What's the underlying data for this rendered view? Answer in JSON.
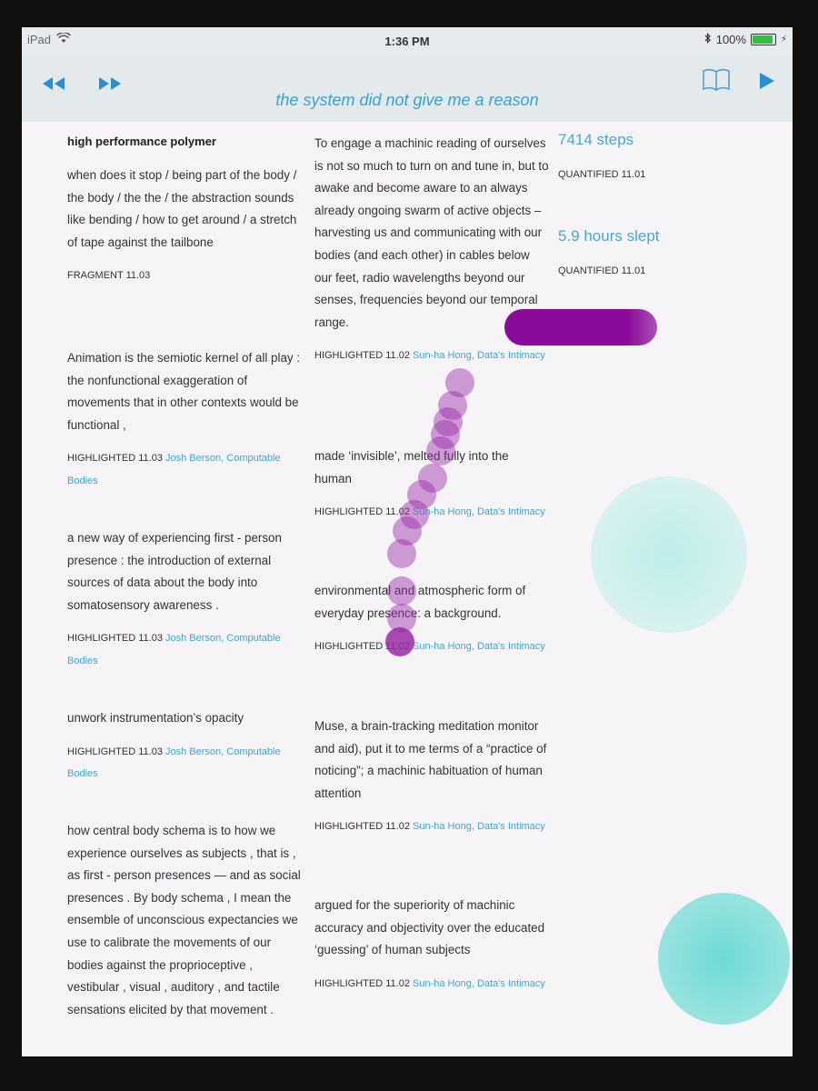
{
  "status": {
    "device": "iPad",
    "time": "1:36 PM",
    "battery_text": "100%",
    "battery_level": 1.0
  },
  "navbar": {
    "title": "the system did not give me a reason",
    "icons": [
      "rewind-icon",
      "fast-forward-icon",
      "book-icon",
      "play-icon"
    ]
  },
  "column1": [
    {
      "title": "high performance polymer",
      "text": "when does it stop / being part of the body / the body / the the / the abstraction sounds like bending / how to get around / a stretch of tape against the tailbone",
      "meta": "FRAGMENT 11.03",
      "source": ""
    },
    {
      "title": "",
      "text": "Animation is the semiotic kernel of all play : the nonfunctional exaggeration of movements that in other contexts would be functional ,",
      "meta": "HIGHLIGHTED 11.03",
      "source": "Josh Berson, Computable Bodies"
    },
    {
      "title": "",
      "text": "a new way of experiencing first - person presence : the introduction of external sources of data about the body into somatosensory awareness .",
      "meta": "HIGHLIGHTED 11.03",
      "source": "Josh Berson, Computable Bodies"
    },
    {
      "title": "",
      "text": "unwork instrumentation’s opacity",
      "meta": "HIGHLIGHTED 11.03",
      "source": "Josh Berson, Computable Bodies"
    },
    {
      "title": "",
      "text": "how central body schema is to how we experience ourselves as subjects , that is , as first - person presences — and as social presences . By body schema , I mean the ensemble of unconscious expectancies we use to calibrate the movements of our bodies against the proprioceptive , vestibular , visual , auditory , and tactile sensations elicited by that movement .",
      "meta": "",
      "source": ""
    }
  ],
  "column2": [
    {
      "text": "To engage a machinic reading of ourselves is not so much to turn on and tune in, but to awake and become aware to an always already ongoing swarm of active objects – harvesting us and communicating with our bodies (and each other) in cables below our feet, radio wavelengths beyond our senses, frequencies beyond our temporal range.",
      "meta": "HIGHLIGHTED 11.02",
      "source": "Sun-ha Hong, Data's Intimacy"
    },
    {
      "text": "made ‘invisible’, melted fully into the human",
      "meta": "HIGHLIGHTED 11.02",
      "source": "Sun-ha Hong, Data's Intimacy"
    },
    {
      "text": "environmental and atmospheric form of everyday presence: a background.",
      "meta": "HIGHLIGHTED 11.02",
      "source": "Sun-ha Hong, Data's Intimacy"
    },
    {
      "text": "Muse, a brain-tracking meditation monitor and aid), put it to me terms of a “practice of noticing”; a machinic habituation of human attention",
      "meta": "HIGHLIGHTED 11.02",
      "source": "Sun-ha Hong, Data's Intimacy"
    },
    {
      "text": "argued for the superiority of machinic accuracy and objectivity over the educated ‘guessing’ of human subjects",
      "meta": "HIGHLIGHTED 11.02",
      "source": "Sun-ha Hong, Data's Intimacy"
    }
  ],
  "column3": [
    {
      "value": "7414 steps",
      "meta": "QUANTIFIED 11.01"
    },
    {
      "value": "5.9 hours slept",
      "meta": "QUANTIFIED 11.01"
    }
  ],
  "colors": {
    "accent": "#3ba6cf",
    "nav_bg": "#e4e9ec",
    "purple_dots": "#9a2aa8",
    "purple_bar": "#8a0a99",
    "teal_blob": "#5fd6cf"
  }
}
